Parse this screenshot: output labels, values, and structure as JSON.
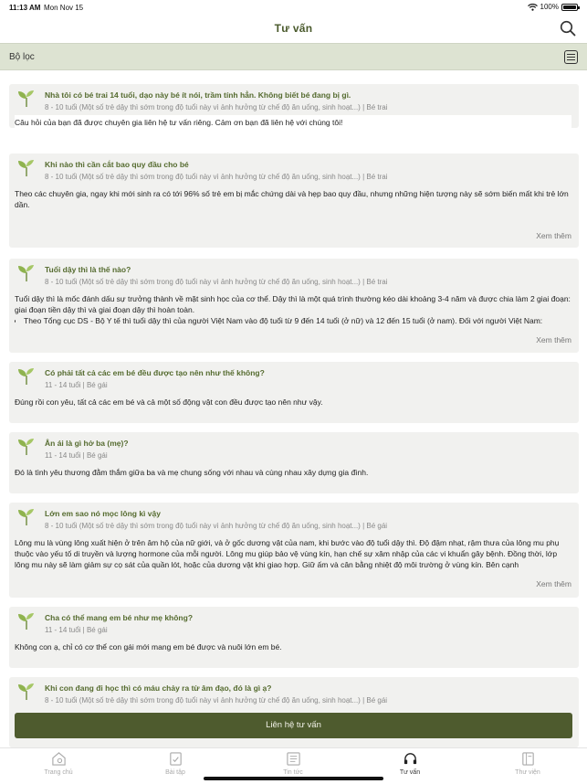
{
  "status_bar": {
    "time": "11:13 AM",
    "date": "Mon Nov 15",
    "battery": "100%"
  },
  "header": {
    "title": "Tư vấn",
    "search_icon": "search-icon"
  },
  "filter": {
    "label": "Bộ lọc",
    "icon": "filter-sliders-icon"
  },
  "colors": {
    "accent": "#556b2f",
    "button": "#4e5b2e",
    "filter_bg": "#dde3d2",
    "card_bg": "#f1f1ef"
  },
  "cards": [
    {
      "title": "Nhà tôi có bé trai 14 tuổi, dạo này bé ít nói, trầm tính hẳn. Không biết bé đang bị gì.",
      "meta": "8 - 10 tuổi (Một số trẻ dậy thì sớm trong độ tuổi này vì ảnh hưởng từ chế độ ăn uống, sinh hoạt...) | Bé trai",
      "answer": "Câu hỏi của bạn đã được chuyên gia liên hệ tư vấn riêng. Cảm ơn bạn đã liên hệ với chúng tôi!"
    },
    {
      "title": "Khi nào thì cần cắt bao quy đầu cho bé",
      "meta": "8 - 10 tuổi (Một số trẻ dậy thì sớm trong độ tuổi này vì ảnh hưởng từ chế độ ăn uống, sinh hoạt...) | Bé trai",
      "answer": "Theo các chuyên gia, ngay khi mới sinh ra có tới 96% số trẻ em bị mắc chứng dài và hẹp bao quy đầu, nhưng những hiện tượng này sẽ sớm biến mất khi trẻ lớn dần.",
      "see_more": "Xem thêm"
    },
    {
      "title": "Tuổi  dậy thì  là thế nào?",
      "meta": "8 - 10 tuổi (Một số trẻ dậy thì sớm trong độ tuổi này vì ảnh hưởng từ chế độ ăn uống, sinh hoạt...) | Bé trai",
      "answer": "Tuổi  dậy thì là mốc đánh dấu sự trưởng thành về mặt sinh học của cơ thể. Dậy thì là một quá trình thường kéo dài khoảng 3-4 năm và được chia làm 2 giai đoạn: giai đoạn tiền dậy thì và giai đoạn dậy thì hoàn toàn.",
      "bullet": "Theo Tổng cục DS - Bộ Y tế thì tuổi dậy thì của người Việt Nam vào độ tuổi từ 9 đến 14 tuổi (ở nữ) và 12 đến 15 tuổi (ở nam). Đối với người Việt Nam:",
      "see_more": "Xem thêm"
    },
    {
      "title": "Có phải tất cả các em bé đều được tạo nên như thế không?",
      "meta": "11 - 14 tuổi | Bé gái",
      "answer": "Đúng rồi con yêu, tất cả các em bé và cả một số động vật con đều được tạo nên như vậy."
    },
    {
      "title": "Ân ái là gì hở ba (mẹ)?",
      "meta": "11 - 14 tuổi | Bé gái",
      "answer": "Đó là tình yêu thương đằm thắm giữa ba và mẹ chung sống với nhau và cùng nhau xây dựng gia đình."
    },
    {
      "title": "Lớn em sao nó mọc lông kì vậy",
      "meta": "8 - 10 tuổi (Một số trẻ dậy thì sớm trong độ tuổi này vì ảnh hưởng từ chế độ ăn uống, sinh hoạt...) | Bé gái",
      "answer": "Lông mu là vùng lông xuất hiện ở trên âm hộ của nữ giới, và ở gốc dương vật của nam, khi bước vào độ tuổi dậy thì. Độ đậm nhạt, rậm thưa của lông mu phụ thuộc vào yếu tố di truyền và lượng hormone của mỗi người. Lông mu giúp bảo vệ vùng kín, hạn chế sự xâm nhập của các vi khuẩn gây bệnh. Đồng thời, lớp lông mu này sẽ làm giảm sự cọ sát của quần lót, hoặc của dương vật khi giao hợp. Giữ ấm và cân bằng nhiệt độ môi trường ở vùng kín. Bên cạnh",
      "see_more": "Xem thêm"
    },
    {
      "title": "Cha có thể mang em bé như mẹ không?",
      "meta": "11 - 14 tuổi | Bé gái",
      "answer": "Không con ạ, chỉ có cơ thể con gái mới mang em bé được và nuôi lớn em bé."
    },
    {
      "title": "Khi con đang đi học thì có máu chảy ra từ âm đạo, đó là gì ạ?",
      "meta": "8 - 10 tuổi (Một số trẻ dậy thì sớm trong độ tuổi này vì ảnh hưởng từ chế độ ăn uống, sinh hoạt...) | Bé gái",
      "answer": ""
    }
  ],
  "contact_button": "Liên hệ tư vấn",
  "tabs": [
    {
      "label": "Trang chủ",
      "icon": "home-icon"
    },
    {
      "label": "Bài tập",
      "icon": "exercise-icon"
    },
    {
      "label": "Tin tức",
      "icon": "news-icon"
    },
    {
      "label": "Tư vấn",
      "icon": "headset-icon",
      "active": true
    },
    {
      "label": "Thư viện",
      "icon": "library-icon"
    }
  ]
}
